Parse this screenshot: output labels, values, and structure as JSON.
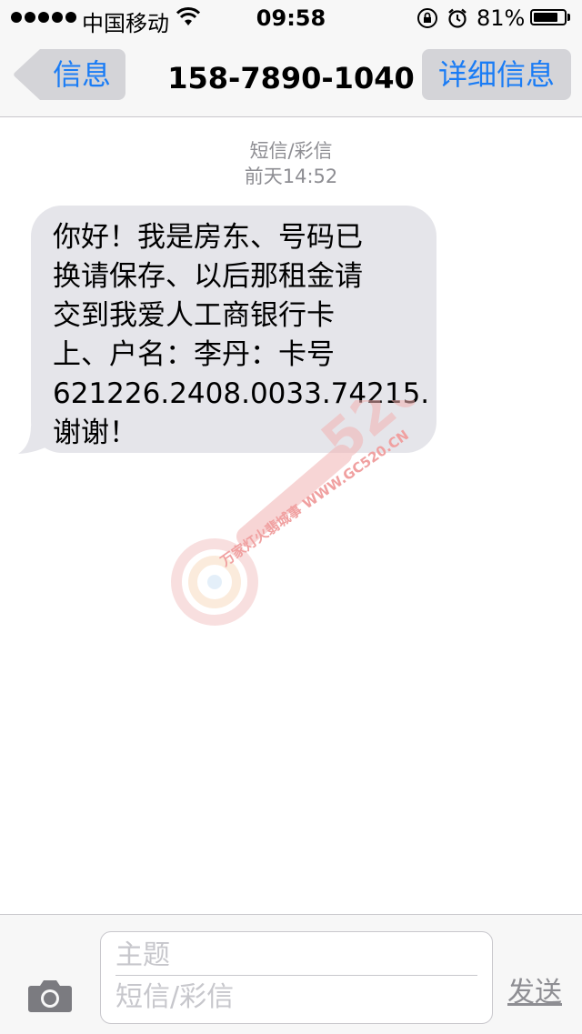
{
  "status_bar": {
    "carrier": "中国移动",
    "time": "09:58",
    "battery_percent_label": "81%",
    "battery_level": 0.81,
    "icons": [
      "signal-dots-icon",
      "wifi-icon",
      "rotation-lock-icon",
      "alarm-icon",
      "battery-icon"
    ]
  },
  "nav": {
    "back_label": "信息",
    "title": "158-7890-1040",
    "details_label": "详细信息"
  },
  "conversation": {
    "message_type": "短信/彩信",
    "timestamp": "前天14:52",
    "message": {
      "lines": [
        "你好！我是房东、号码已",
        "换请保存、以后那租金请",
        "交到我爱人工商银行卡",
        "上、户名：李丹：卡号",
        "621226.2408.0033.74215.",
        "谢谢！"
      ]
    }
  },
  "watermark": {
    "text": "万家灯火翡城事 WWW.GC520.CN"
  },
  "input_bar": {
    "subject_placeholder": "主题",
    "body_placeholder": "短信/彩信",
    "send_label": "发送"
  },
  "colors": {
    "accent": "#1a7cf5",
    "bubble": "#e5e5ea",
    "bar_background": "#f7f7f7",
    "meta_text": "#8e8e93"
  }
}
